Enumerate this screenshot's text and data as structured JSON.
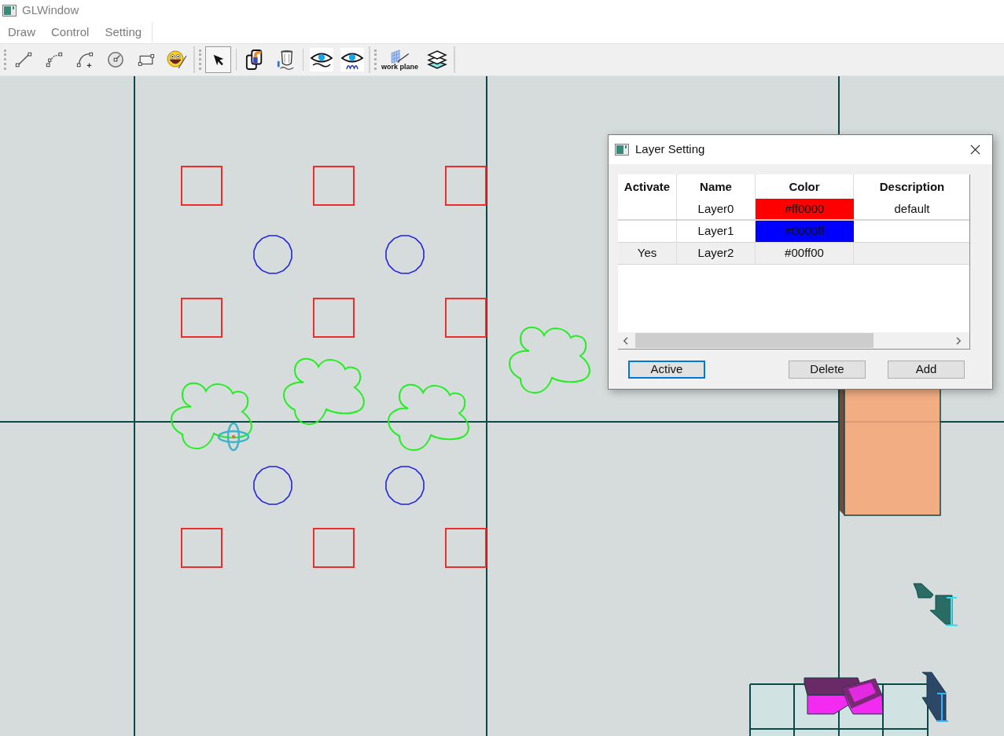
{
  "window": {
    "title": "GLWindow"
  },
  "menu": [
    "Draw",
    "Control",
    "Setting"
  ],
  "toolbars": [
    {
      "groups": [
        {
          "tools": [
            {
              "selected": false
            },
            {
              "selected": false
            },
            {
              "selected": false
            },
            {
              "selected": false
            },
            {
              "selected": false
            },
            {
              "selected": false
            }
          ]
        }
      ]
    },
    {
      "groups": [
        {
          "tools": [
            {
              "selected": true
            }
          ]
        },
        {
          "tools": [
            {
              "selected": false
            },
            {
              "selected": false
            }
          ]
        },
        {
          "tools": [
            {
              "selected": false
            },
            {
              "selected": false
            }
          ]
        }
      ]
    },
    {
      "groups": [
        {
          "tools": [
            {
              "selected": false,
              "caption": "work plane"
            },
            {
              "selected": false
            }
          ]
        }
      ]
    }
  ],
  "layer_dialog": {
    "title": "Layer Setting",
    "table": {
      "columns": [
        "Activate",
        "Name",
        "Color",
        "Description"
      ],
      "rows": [
        {
          "name": "Layer0",
          "color_code": "#ff0000",
          "color": "#ff0000",
          "description": "default",
          "selected": false
        },
        {
          "name": "Layer1",
          "color_code": "#0000ff",
          "color": "#0000ff",
          "selected": false
        },
        {
          "activated": "Yes",
          "name": "Layer2",
          "color_code": "#00ff00",
          "selected": true
        }
      ]
    },
    "buttons": [
      {
        "label": "Active",
        "focused": true
      },
      {
        "label": "Delete",
        "focused": false
      },
      {
        "label": "Add",
        "focused": false
      }
    ]
  }
}
